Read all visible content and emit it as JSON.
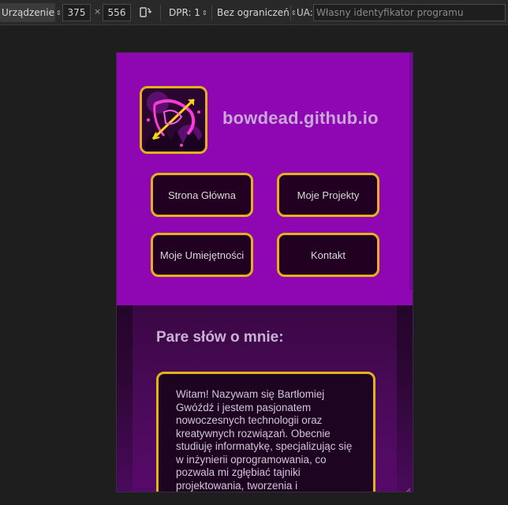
{
  "toolbar": {
    "device_label": "Urządzenie",
    "width": "375",
    "times": "×",
    "height": "556",
    "dpr_label": "DPR: 1",
    "throttle_label": "Bez ograniczeń",
    "ua_label": "UA:",
    "ua_placeholder": "Własny identyfikator programu"
  },
  "site": {
    "title": "bowdead.github.io",
    "nav": [
      {
        "label": "Strona Główna"
      },
      {
        "label": "Moje Projekty"
      },
      {
        "label": "Moje Umiejętności"
      },
      {
        "label": "Kontakt"
      }
    ],
    "about": {
      "heading": "Pare słów o mnie:",
      "text": "Witam! Nazywam się Bartłomiej Gwóźdź i jestem pasjonatem nowoczesnych technologii oraz kreatywnych rozwiązań. Obecnie studiuję informatykę, specjalizując się w inżynierii oprogramowania, co pozwala mi zgłębiać tajniki projektowania, tworzenia i"
    }
  },
  "colors": {
    "header_bg": "#8e07b3",
    "accent_gold": "#e3b219",
    "button_bg": "#220022",
    "page_bg": "#1e1e1e"
  },
  "icons": {
    "logo": "bow-and-arrow-logo",
    "rotate": "rotate-icon",
    "resize": "resize-grip-icon"
  }
}
